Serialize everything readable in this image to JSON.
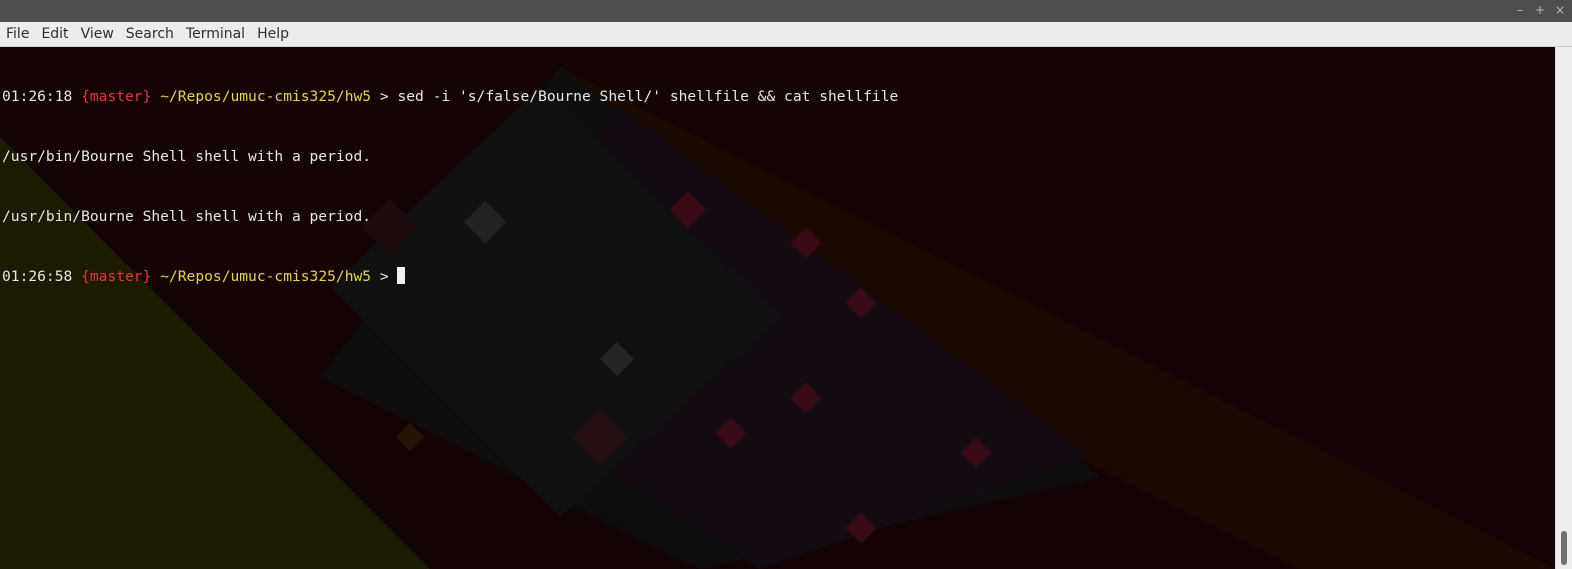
{
  "window": {
    "controls": {
      "minimize": "–",
      "maximize": "+",
      "close": "×"
    }
  },
  "menubar": {
    "items": [
      "File",
      "Edit",
      "View",
      "Search",
      "Terminal",
      "Help"
    ]
  },
  "terminal": {
    "lines": [
      {
        "time": "01:26:18",
        "branch": "{master}",
        "path": "~/Repos/umuc-cmis325/hw5",
        "prompt": ">",
        "command": "sed -i 's/false/Bourne Shell/' shellfile && cat shellfile"
      },
      {
        "output": "/usr/bin/Bourne Shell shell with a period."
      },
      {
        "output": "/usr/bin/Bourne Shell shell with a period."
      },
      {
        "time": "01:26:58",
        "branch": "{master}",
        "path": "~/Repos/umuc-cmis325/hw5",
        "prompt": ">",
        "command": ""
      }
    ]
  },
  "colors": {
    "branch": "#e8383a",
    "path": "#e9d256",
    "text": "#e8e8e8",
    "background": "#140404"
  }
}
